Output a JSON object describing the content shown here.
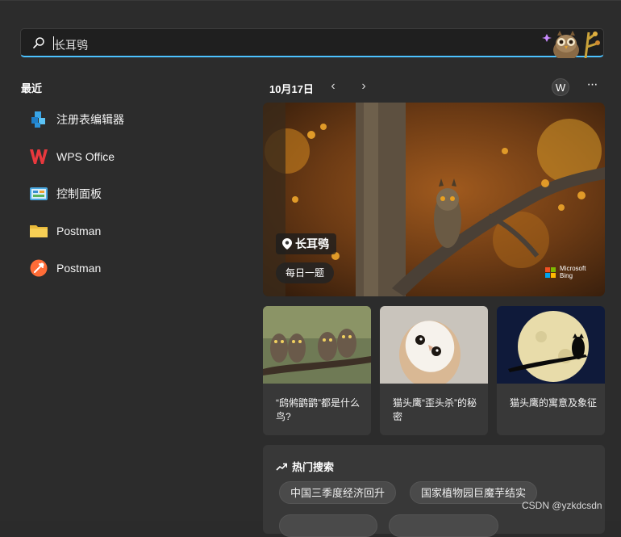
{
  "search": {
    "value": "长耳鸮"
  },
  "left": {
    "title": "最近",
    "apps": [
      {
        "label": "注册表编辑器",
        "icon": "registry-editor-icon"
      },
      {
        "label": "WPS Office",
        "icon": "wps-office-icon"
      },
      {
        "label": "控制面板",
        "icon": "control-panel-icon"
      },
      {
        "label": "Postman",
        "icon": "folder-icon"
      },
      {
        "label": "Postman",
        "icon": "postman-icon"
      }
    ]
  },
  "header": {
    "date": "10月17日",
    "prev": "‹",
    "next": "›",
    "avatar": "W",
    "more": "···"
  },
  "hero": {
    "tag": "长耳鸮",
    "button": "每日一题",
    "brand_line1": "Microsoft",
    "brand_line2": "Bing"
  },
  "cards": [
    {
      "caption": "“鸱鸺鹠鹠”都是什么鸟?"
    },
    {
      "caption": "猫头鹰“歪头杀”的秘密"
    },
    {
      "caption": "猫头鹰的寓意及象征"
    }
  ],
  "trending": {
    "title": "热门搜索",
    "pills": [
      "中国三季度经济回升",
      "国家植物园巨魔芋结实"
    ]
  },
  "watermark": "CSDN @yzkdcsdn",
  "colors": {
    "accent": "#4cc2ff",
    "background": "#2c2c2c",
    "card": "#383838"
  }
}
